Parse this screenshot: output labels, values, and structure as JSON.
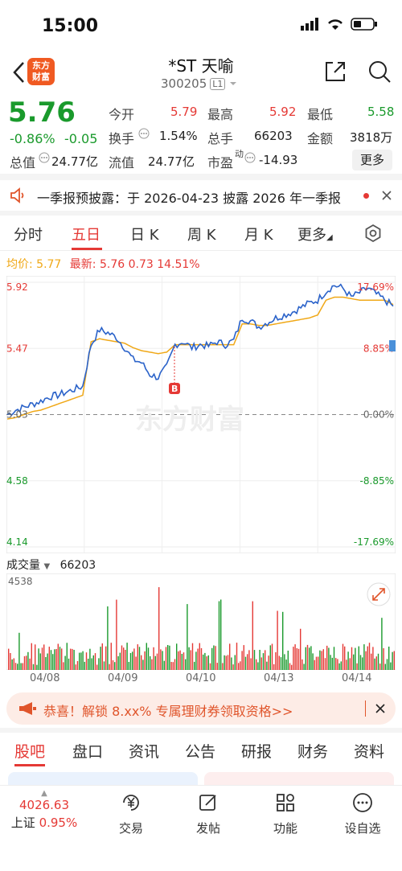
{
  "status": {
    "time": "15:00"
  },
  "header": {
    "logo_text": "东方\n财富",
    "title": "*ST 天喻",
    "code": "300205",
    "level": "L1"
  },
  "quote": {
    "price": "5.76",
    "change_pct": "-0.86%",
    "change": "-0.05",
    "open_label": "今开",
    "open": "5.79",
    "high_label": "最高",
    "high": "5.92",
    "low_label": "最低",
    "low": "5.58",
    "turnover_label": "换手",
    "turnover": "1.54%",
    "volume_label": "总手",
    "volume": "66203",
    "amount_label": "金额",
    "amount": "3818万",
    "mktcap_label": "总值",
    "mktcap": "24.77亿",
    "float_label": "流值",
    "float": "24.77亿",
    "pe_label": "市盈",
    "pe_sup": "动",
    "pe": "-14.93",
    "more": "更多"
  },
  "notice": {
    "text": "一季报预披露：于 2026-04-23 披露 2026 年一季报"
  },
  "chart_tabs": [
    "分时",
    "五日",
    "日 K",
    "周 K",
    "月 K",
    "更多"
  ],
  "info": {
    "avg_label": "均价:",
    "avg": "5.77",
    "latest_label": "最新:",
    "latest": "5.76",
    "latest_chg": "0.73",
    "latest_pct": "14.51%"
  },
  "chart_data": {
    "type": "line",
    "title": "",
    "y_ticks_left": [
      "5.92",
      "5.47",
      "5.03",
      "4.58",
      "4.14"
    ],
    "y_ticks_right": [
      "17.69%",
      "8.85%",
      "0.00%",
      "-8.85%",
      "-17.69%"
    ],
    "ylim": [
      4.14,
      5.92
    ],
    "x_categories": [
      "04/08",
      "04/09",
      "04/10",
      "04/13",
      "04/14"
    ],
    "series": [
      {
        "values": [
          5.03,
          5.06,
          5.08,
          5.1,
          5.12,
          5.15,
          5.16,
          5.18,
          5.2,
          5.22,
          5.5,
          5.6,
          5.58,
          5.55,
          5.48,
          5.4,
          5.38,
          5.3,
          5.28,
          5.35,
          5.5,
          5.52,
          5.48,
          5.5,
          5.49,
          5.52,
          5.5,
          5.53,
          5.68,
          5.66,
          5.62,
          5.65,
          5.68,
          5.7,
          5.72,
          5.75,
          5.78,
          5.8,
          5.86,
          5.9,
          5.88,
          5.82,
          5.85,
          5.88,
          5.84,
          5.8,
          5.76
        ]
      },
      {
        "values": [
          5.0,
          5.01,
          5.03,
          5.05,
          5.06,
          5.08,
          5.1,
          5.12,
          5.14,
          5.16,
          5.52,
          5.54,
          5.53,
          5.52,
          5.51,
          5.48,
          5.46,
          5.45,
          5.44,
          5.45,
          5.5,
          5.5,
          5.5,
          5.5,
          5.5,
          5.5,
          5.5,
          5.5,
          5.64,
          5.64,
          5.63,
          5.63,
          5.64,
          5.65,
          5.66,
          5.67,
          5.68,
          5.7,
          5.8,
          5.82,
          5.82,
          5.81,
          5.8,
          5.8,
          5.8,
          5.8,
          5.77
        ]
      }
    ],
    "colors": {
      "price": "#2a62c9",
      "avg": "#f0a817",
      "up": "#e53935",
      "down": "#1a9a2c"
    }
  },
  "volume": {
    "label": "成交量",
    "value": "66203",
    "max_label": "4538"
  },
  "banner": {
    "text": "恭喜！解锁 8.xx% 专属理财券领取资格>>"
  },
  "bottom_tabs": [
    "股吧",
    "盘口",
    "资讯",
    "公告",
    "研报",
    "财务",
    "资料"
  ],
  "nav": {
    "index_value": "4026.63",
    "index_name": "上证",
    "index_pct": "0.95%",
    "items": [
      "交易",
      "发帖",
      "功能",
      "设自选"
    ]
  }
}
